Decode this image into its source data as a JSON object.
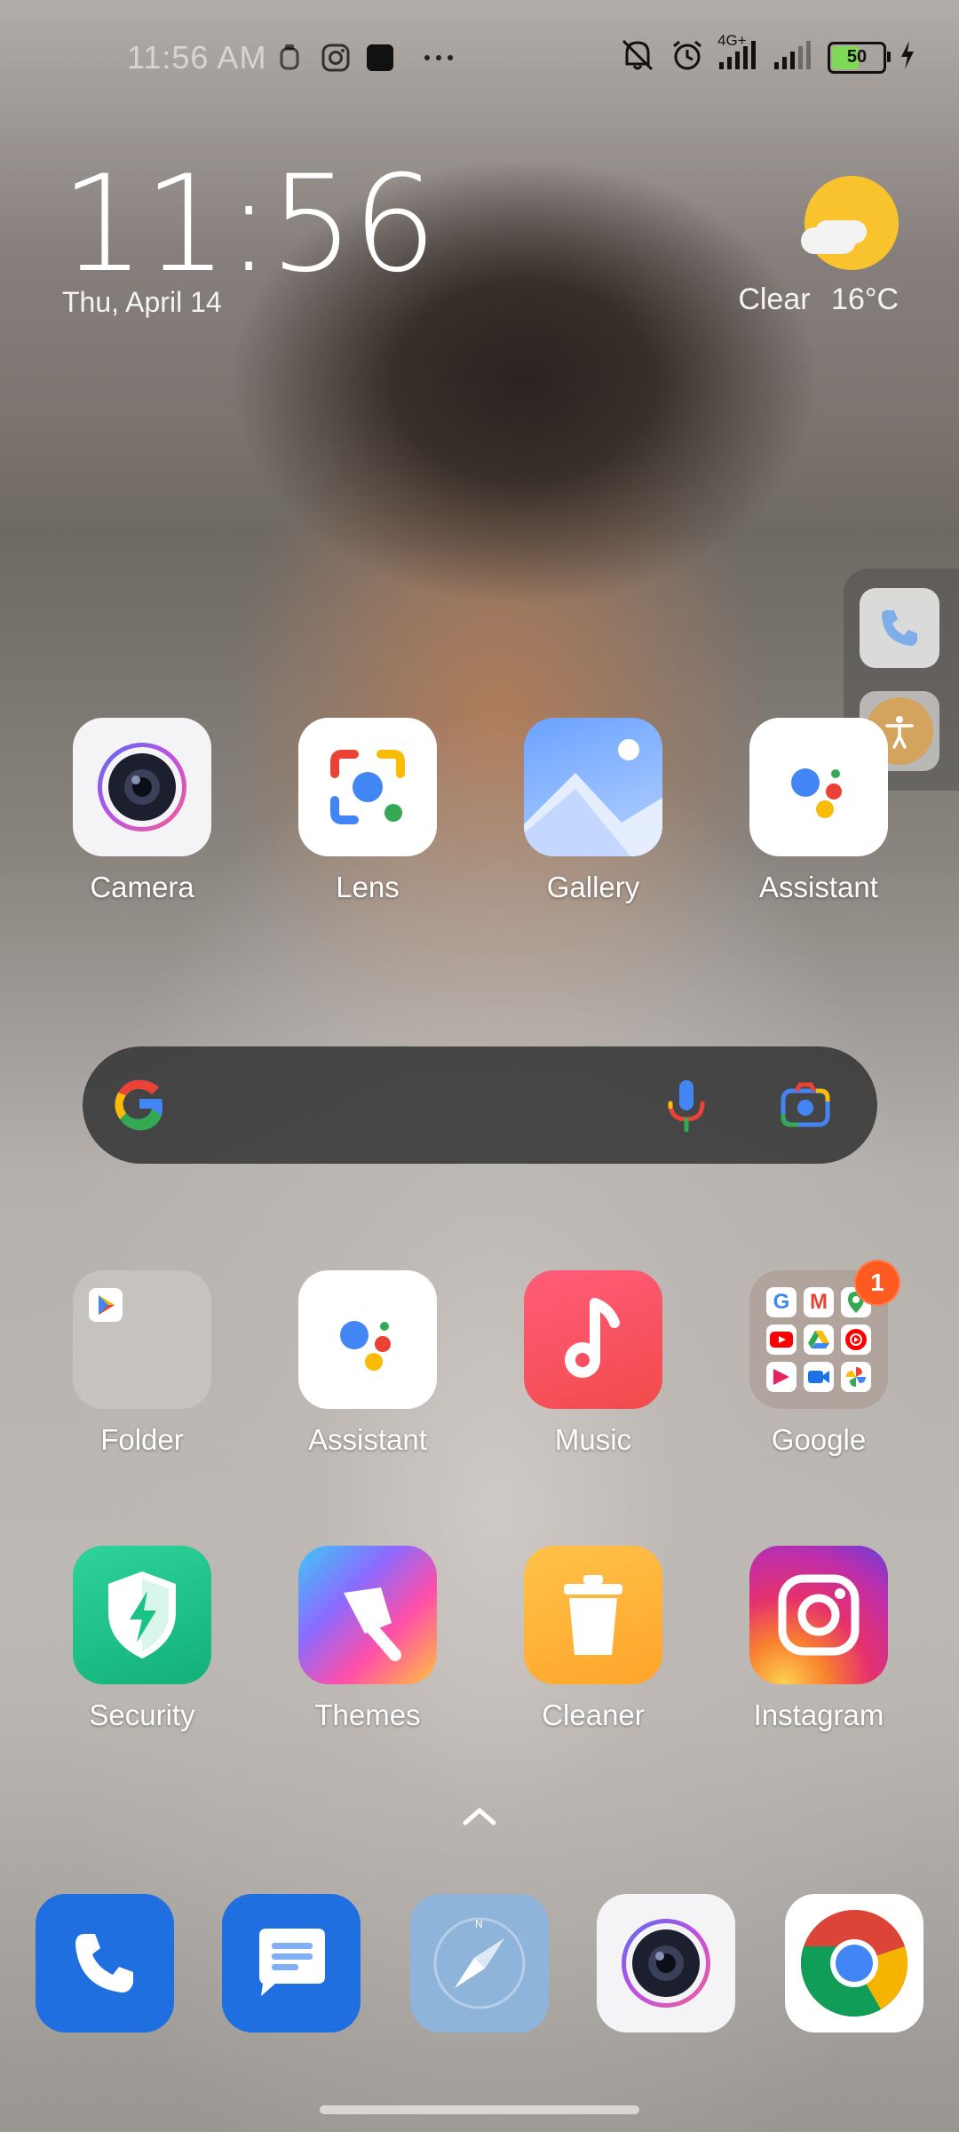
{
  "status_bar": {
    "time": "11:56 AM",
    "network": "4G+",
    "battery": "50",
    "battery_level": 0.5,
    "icons": [
      "silent-icon",
      "alarm-icon",
      "signal-icon",
      "signal-icon-2",
      "battery-icon",
      "charging-icon",
      "notification-app-icon",
      "instagram-icon",
      "square-app-icon",
      "more-icon"
    ]
  },
  "clock_widget": {
    "time": "11:56",
    "date": "Thu, April 14"
  },
  "weather_widget": {
    "condition": "Clear",
    "temperature": "16°C"
  },
  "apps_row1": [
    {
      "label": "Camera"
    },
    {
      "label": "Lens"
    },
    {
      "label": "Gallery"
    },
    {
      "label": "Assistant"
    }
  ],
  "apps_row2": [
    {
      "label": "Folder"
    },
    {
      "label": "Assistant"
    },
    {
      "label": "Music"
    },
    {
      "label": "Google",
      "badge": "1"
    }
  ],
  "apps_row3": [
    {
      "label": "Security"
    },
    {
      "label": "Themes"
    },
    {
      "label": "Cleaner"
    },
    {
      "label": "Instagram"
    }
  ],
  "dock": [
    "phone-app",
    "messages-app",
    "compass-app",
    "camera-app",
    "chrome-app"
  ],
  "colors": {
    "google_blue": "#4285f4",
    "google_red": "#ea4335",
    "google_yellow": "#fbbc05",
    "google_green": "#34a853",
    "badge": "#ff5a1f"
  }
}
